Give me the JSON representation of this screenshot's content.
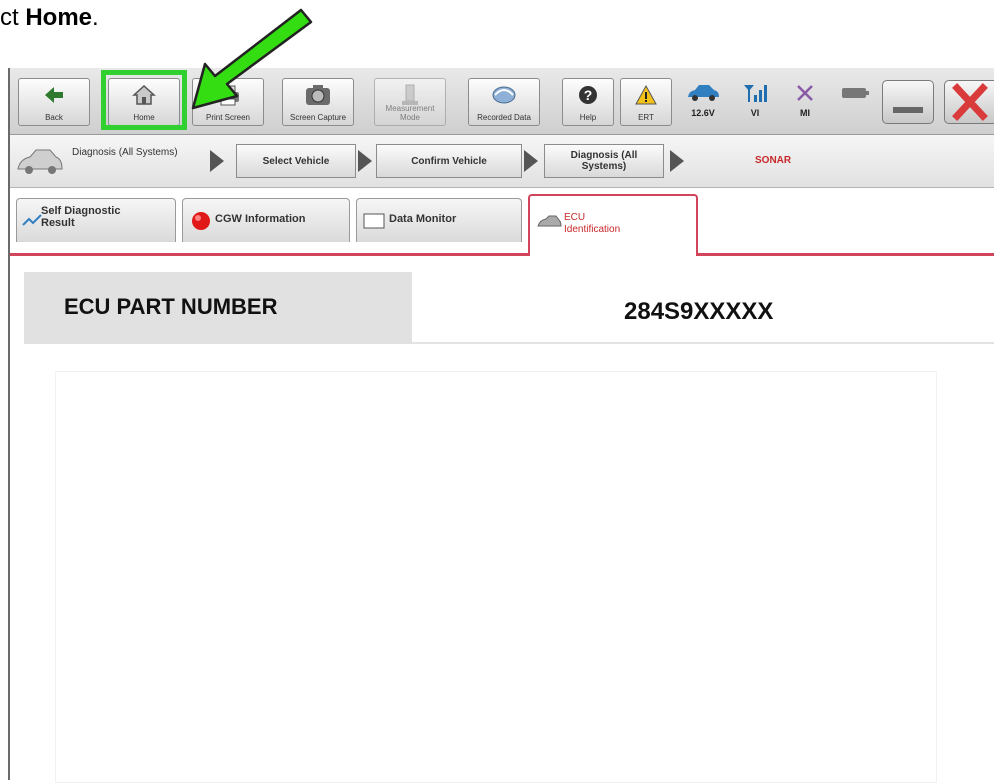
{
  "caption": {
    "prefix": "ct ",
    "emphasis": "Home",
    "suffix": "."
  },
  "toolbar": {
    "buttons": [
      {
        "id": "back",
        "label": "Back",
        "icon": "back-arrow-icon"
      },
      {
        "id": "home",
        "label": "Home",
        "icon": "home-icon"
      },
      {
        "id": "print",
        "label": "Print Screen",
        "icon": "printer-icon"
      },
      {
        "id": "capture",
        "label": "Screen Capture",
        "icon": "camera-icon"
      },
      {
        "id": "measure",
        "label": "Measurement Mode",
        "icon": "measurement-icon"
      },
      {
        "id": "recorded",
        "label": "Recorded Data",
        "icon": "recorded-data-icon"
      },
      {
        "id": "help",
        "label": "Help",
        "icon": "help-icon"
      },
      {
        "id": "ert",
        "label": "ERT",
        "icon": "warning-icon"
      }
    ],
    "status": [
      {
        "id": "battery",
        "label": "12.6V",
        "icon": "car-icon"
      },
      {
        "id": "vi",
        "label": "VI",
        "icon": "signal-icon"
      },
      {
        "id": "mi",
        "label": "MI",
        "icon": "x-mark-icon"
      }
    ]
  },
  "breadcrumb": {
    "first": "Diagnosis (All Systems)",
    "steps": [
      "Select Vehicle",
      "Confirm Vehicle",
      "Diagnosis (All Systems)"
    ],
    "current": "SONAR"
  },
  "tabs": [
    {
      "label": "Self Diagnostic Result",
      "line1": "Self Diagnostic",
      "line2": "Result",
      "active": false
    },
    {
      "label": "CGW Information",
      "active": false
    },
    {
      "label": "Data Monitor",
      "active": false
    },
    {
      "label": "ECU Identification",
      "line1": "ECU",
      "line2": "Identification",
      "active": true
    }
  ],
  "ecu": {
    "key": "ECU PART NUMBER",
    "value": "284S9XXXXX"
  },
  "colors": {
    "highlight": "#2fd02f",
    "arrow": "#33dd11",
    "active_tab": "#d2445a",
    "current_step": "#c8282a"
  }
}
